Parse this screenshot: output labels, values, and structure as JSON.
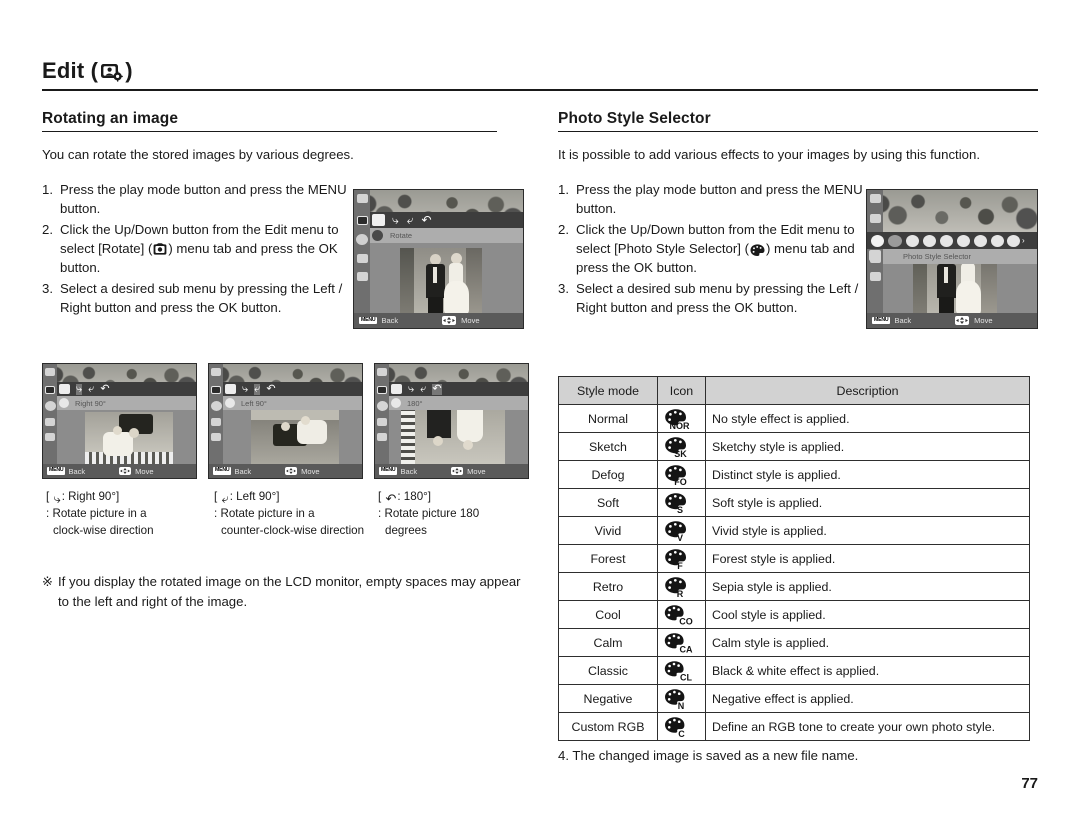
{
  "header": {
    "title_prefix": "Edit (",
    "title_suffix": ")",
    "icon": "edit-photo-icon"
  },
  "left_column": {
    "section_title": "Rotating an image",
    "intro": "You can rotate the stored images by various degrees.",
    "steps": [
      {
        "num": "1.",
        "text": "Press the play mode button and press the MENU button."
      },
      {
        "num": "2.",
        "text_before": "Click the Up/Down button from the Edit menu to select [Rotate] (",
        "icon": "rotate-menu-icon",
        "text_after": ") menu tab and press the OK button."
      },
      {
        "num": "3.",
        "text": "Select a desired sub menu by pressing the Left / Right button and press the OK button."
      }
    ],
    "lcd_main": {
      "menu_label": "Rotate",
      "back_chip": "MENU",
      "back_label": "Back",
      "move_label": "Move"
    },
    "thumbnails": [
      {
        "label": "Right 90°",
        "back_chip": "MENU",
        "back_label": "Back",
        "move_label": "Move"
      },
      {
        "label": "Left 90°",
        "back_chip": "MENU",
        "back_label": "Back",
        "move_label": "Move"
      },
      {
        "label": "180°",
        "back_chip": "MENU",
        "back_label": "Back",
        "move_label": "Move"
      }
    ],
    "captions": [
      {
        "icon": "rotate-right-icon",
        "head_suffix": ": Right 90°]",
        "head_prefix": "[ ",
        "line1": ": Rotate picture in a",
        "line2": "clock-wise direction"
      },
      {
        "icon": "rotate-left-icon",
        "head_suffix": ": Left 90°]",
        "head_prefix": "[ ",
        "line1": ": Rotate picture in a",
        "line2": "counter-clock-wise direction"
      },
      {
        "icon": "rotate-180-icon",
        "head_suffix": ": 180°]",
        "head_prefix": "[ ",
        "line1": ": Rotate picture 180",
        "line2": "degrees"
      }
    ],
    "note": {
      "mark": "※",
      "text": "If you display the rotated image on the LCD monitor, empty spaces may appear to the left and right of the image."
    }
  },
  "right_column": {
    "section_title": "Photo Style Selector",
    "intro": "It is possible to add various effects to your images by using this function.",
    "steps": [
      {
        "num": "1.",
        "text": "Press the play mode button and press the MENU button."
      },
      {
        "num": "2.",
        "text_before": "Click the Up/Down button from the Edit menu to select [Photo Style Selector] (",
        "icon": "palette-icon",
        "text_after": ") menu tab and press the OK button."
      },
      {
        "num": "3.",
        "text": "Select a desired sub menu by pressing the Left / Right button and press the OK button."
      }
    ],
    "lcd_main": {
      "menu_label": "Photo Style Selector",
      "back_chip": "MENU",
      "back_label": "Back",
      "move_label": "Move",
      "palette_tabs": [
        "NOR",
        "SK",
        "FO",
        "S",
        "V",
        "F",
        "R",
        "CO"
      ]
    },
    "table": {
      "headers": [
        "Style mode",
        "Icon",
        "Description"
      ],
      "rows": [
        {
          "mode": "Normal",
          "icon_label": "NOR",
          "description": "No style effect is applied."
        },
        {
          "mode": "Sketch",
          "icon_label": "SK",
          "description": "Sketchy style is applied."
        },
        {
          "mode": "Defog",
          "icon_label": "FO",
          "description": "Distinct style is applied."
        },
        {
          "mode": "Soft",
          "icon_label": "S",
          "description": "Soft style is applied."
        },
        {
          "mode": "Vivid",
          "icon_label": "V",
          "description": "Vivid style is applied."
        },
        {
          "mode": "Forest",
          "icon_label": "F",
          "description": "Forest style is applied."
        },
        {
          "mode": "Retro",
          "icon_label": "R",
          "description": "Sepia style is applied."
        },
        {
          "mode": "Cool",
          "icon_label": "CO",
          "description": "Cool style is applied."
        },
        {
          "mode": "Calm",
          "icon_label": "CA",
          "description": "Calm style is applied."
        },
        {
          "mode": "Classic",
          "icon_label": "CL",
          "description": "Black & white effect is applied."
        },
        {
          "mode": "Negative",
          "icon_label": "N",
          "description": "Negative effect is applied."
        },
        {
          "mode": "Custom RGB",
          "icon_label": "C",
          "description": "Define an RGB tone to create your own photo style."
        }
      ]
    },
    "final_step": "4. The changed image is saved as a new file name."
  },
  "page_number": "77",
  "colors": {
    "text": "#1a1a1a",
    "rule": "#1a1a1a",
    "table_header_bg": "#d2d2d2",
    "table_border": "#2e2e2e",
    "lcd_bg": "#8c8c8c"
  }
}
